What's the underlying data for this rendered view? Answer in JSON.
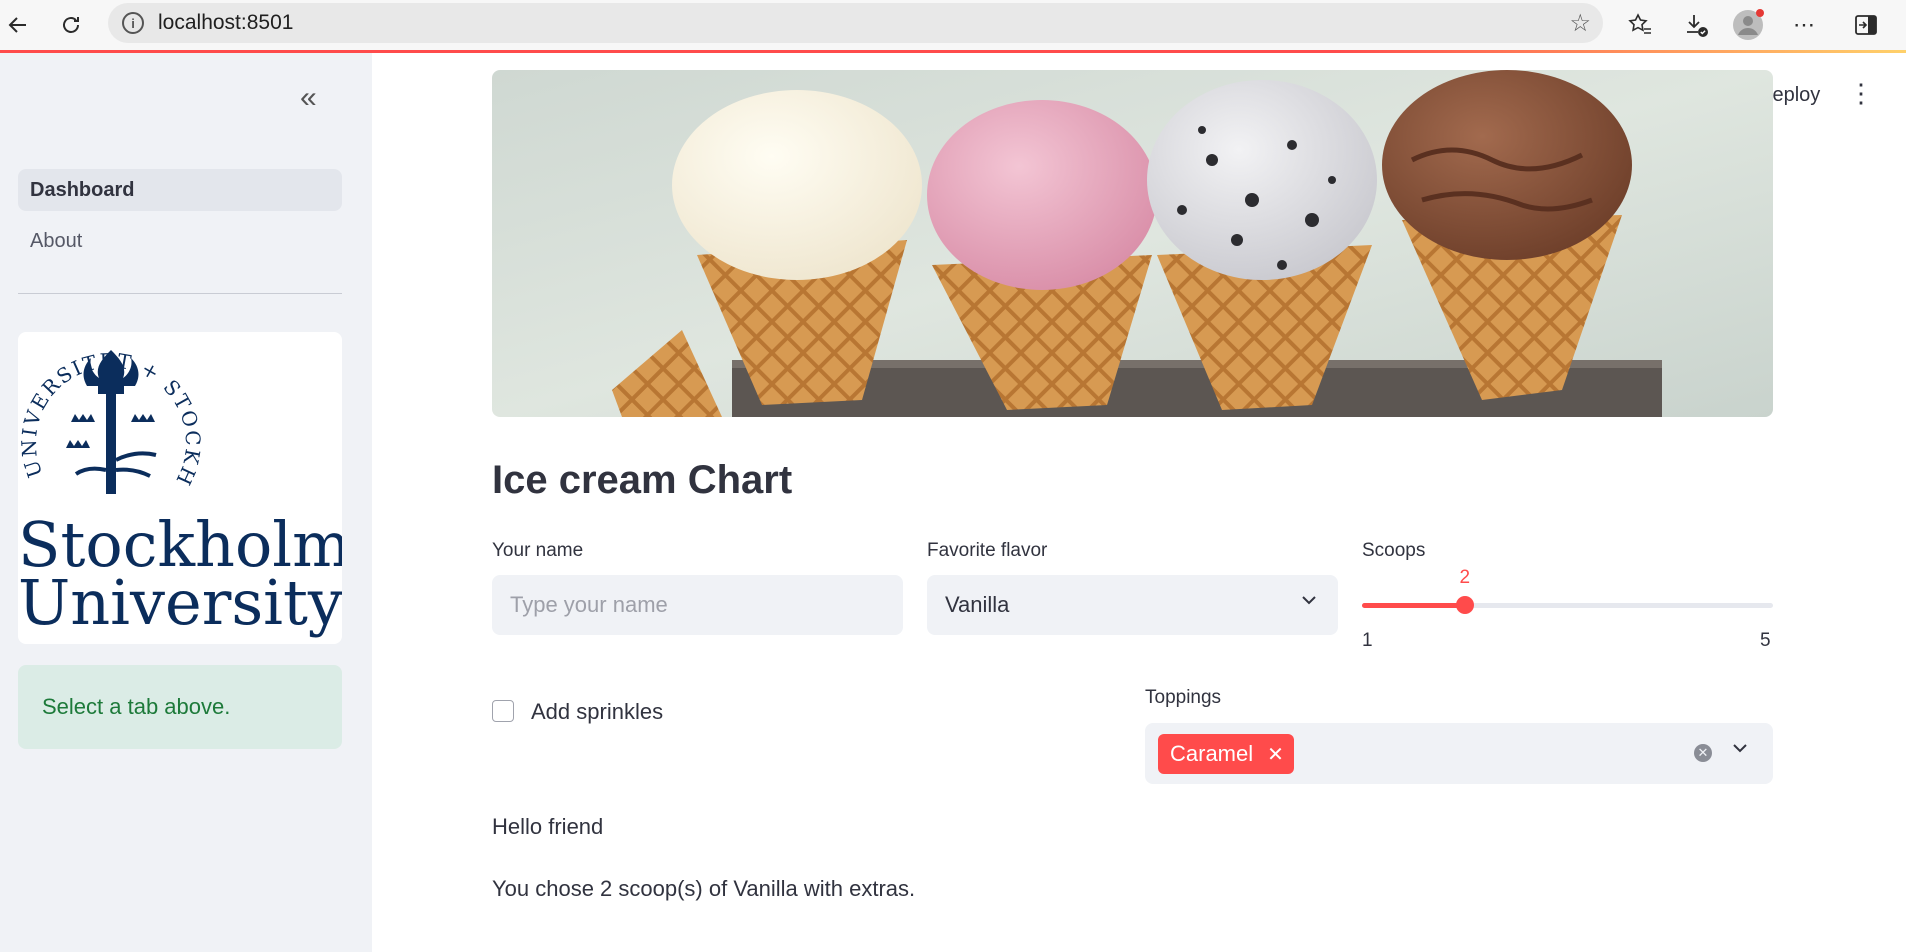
{
  "browser": {
    "url": "localhost:8501"
  },
  "sidebar": {
    "items": [
      {
        "label": "Dashboard",
        "active": true
      },
      {
        "label": "About",
        "active": false
      }
    ],
    "logo": {
      "line1": "Stockholm",
      "line2": "University",
      "seal_text": "UNIVERSITET + STOCKHOLMS"
    },
    "info_message": "Select a tab above."
  },
  "header": {
    "deploy_label": "Deploy"
  },
  "main": {
    "title": "Ice cream Chart",
    "name_field": {
      "label": "Your name",
      "placeholder": "Type your name",
      "value": ""
    },
    "flavor_select": {
      "label": "Favorite flavor",
      "value": "Vanilla"
    },
    "scoops_slider": {
      "label": "Scoops",
      "value": "2",
      "min": "1",
      "max": "5",
      "fraction": 0.25
    },
    "sprinkles_checkbox": {
      "label": "Add sprinkles",
      "checked": false
    },
    "toppings": {
      "label": "Toppings",
      "selected": [
        "Caramel"
      ]
    },
    "greeting": "Hello friend",
    "summary": "You chose 2 scoop(s) of Vanilla with extras."
  },
  "colors": {
    "accent": "#ff4b4b",
    "sidebar_bg": "#f0f2f6",
    "info_bg": "#dbece6",
    "info_text": "#1d7a3a",
    "logo_blue": "#0b2d5c"
  },
  "icons": [
    "back-arrow-icon",
    "reload-icon",
    "info-icon",
    "star-icon",
    "favorites-icon",
    "download-icon",
    "profile-icon",
    "more-icon",
    "sidebar-toggle-icon",
    "collapse-icon",
    "chevron-down-icon",
    "clear-icon",
    "close-icon",
    "kebab-menu-icon"
  ]
}
